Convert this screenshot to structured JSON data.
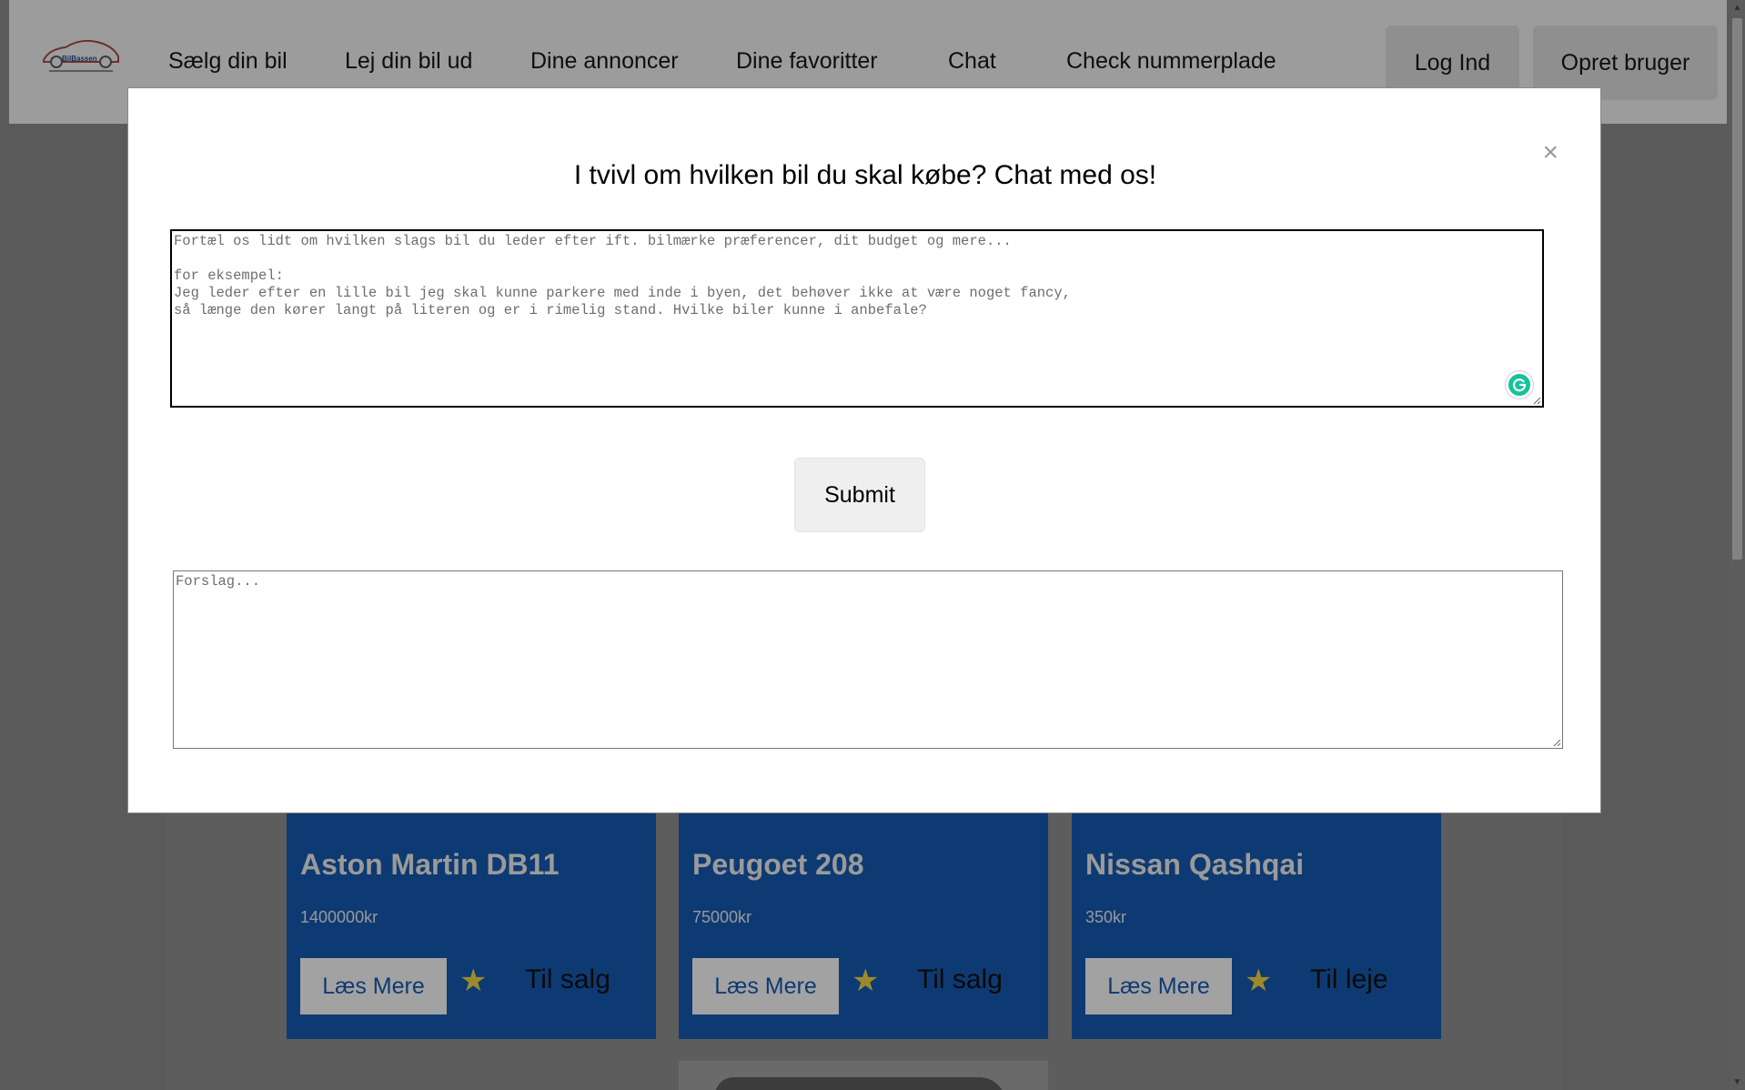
{
  "navbar": {
    "logo_label": "BilBassen",
    "items": [
      {
        "label": "Sælg din bil"
      },
      {
        "label": "Lej din bil ud"
      },
      {
        "label": "Dine annoncer"
      },
      {
        "label": "Dine favoritter"
      },
      {
        "label": "Chat"
      },
      {
        "label": "Check nummerplade"
      }
    ],
    "login_label": "Log Ind",
    "signup_label": "Opret bruger"
  },
  "listings": [
    {
      "title": "Aston Martin DB11",
      "price": "1400000kr",
      "more_label": "Læs Mere",
      "status": "Til salg"
    },
    {
      "title": "Peugoet 208",
      "price": "75000kr",
      "more_label": "Læs Mere",
      "status": "Til salg"
    },
    {
      "title": "Nissan Qashqai",
      "price": "350kr",
      "more_label": "Læs Mere",
      "status": "Til leje"
    }
  ],
  "modal": {
    "close_symbol": "×",
    "title": "I tvivl om hvilken bil du skal købe? Chat med os!",
    "query_placeholder": "Fortæl os lidt om hvilken slags bil du leder efter ift. bilmærke præferencer, dit budget og mere...\n\nfor eksempel:\nJeg leder efter en lille bil jeg skal kunne parkere med inde i byen, det behøver ikke at være noget fancy,\nså længe den kører langt på literen og er i rimelig stand. Hvilke biler kunne i anbefale?",
    "submit_label": "Submit",
    "answer_placeholder": "Forslag..."
  },
  "colors": {
    "overlay_bg": "#5a5a5a",
    "navbar_bg": "#9c9c9c",
    "card_bg": "#0e3a73",
    "star": "#9c8a2a",
    "modal_bg": "#ffffff",
    "grammarly": "#15c39a"
  },
  "icons": {
    "close": "close-icon",
    "star": "star-icon",
    "grammarly": "grammarly-icon",
    "logo": "car-logo-icon"
  }
}
